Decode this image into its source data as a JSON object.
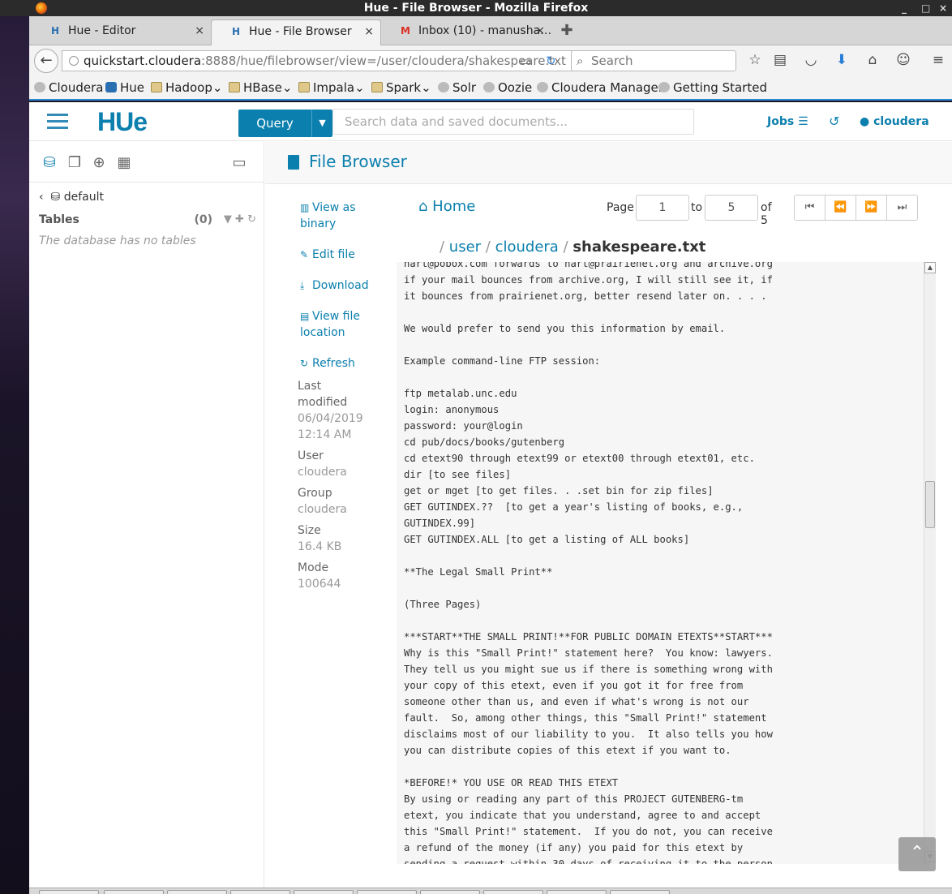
{
  "window": {
    "title": "Hue - File Browser - Mozilla Firefox",
    "controls": [
      "_",
      "□",
      "×"
    ]
  },
  "tabs": [
    {
      "label": "Hue - Editor",
      "icon": "hue-icon",
      "active": false
    },
    {
      "label": "Hue - File Browser",
      "icon": "hue-icon",
      "active": true
    },
    {
      "label": "Inbox (10) - manusha…",
      "icon": "gmail-icon",
      "active": false
    }
  ],
  "newtab_label": "✚",
  "tab_close": "×",
  "nav": {
    "back": "←",
    "url_host": "quickstart.cloudera",
    "url_rest": ":8888/hue/filebrowser/view=/user/cloudera/shakespeare.txt",
    "search_placeholder": "Search"
  },
  "bookmarks": [
    {
      "label": "Cloudera",
      "icon": "globe"
    },
    {
      "label": "Hue",
      "icon": "hue"
    },
    {
      "label": "Hadoop",
      "icon": "folder",
      "menu": true
    },
    {
      "label": "HBase",
      "icon": "folder",
      "menu": true
    },
    {
      "label": "Impala",
      "icon": "folder",
      "menu": true
    },
    {
      "label": "Spark",
      "icon": "folder",
      "menu": true
    },
    {
      "label": "Solr",
      "icon": "globe"
    },
    {
      "label": "Oozie",
      "icon": "globe"
    },
    {
      "label": "Cloudera Manager",
      "icon": "globe"
    },
    {
      "label": "Getting Started",
      "icon": "globe"
    }
  ],
  "header": {
    "logo": "HUe",
    "query_label": "Query",
    "search_placeholder": "Search data and saved documents...",
    "jobs_label": "Jobs",
    "user_label": "cloudera"
  },
  "left_panel": {
    "database": "default",
    "tables_label": "Tables",
    "tables_count": "(0)",
    "empty_message": "The database has no tables"
  },
  "file_browser": {
    "title": "File Browser",
    "actions": {
      "view_binary": [
        "View as",
        "binary"
      ],
      "edit": "Edit file",
      "download": "Download",
      "view_location": [
        "View file",
        "location"
      ],
      "refresh": "Refresh"
    },
    "meta": {
      "last_modified_label": [
        "Last",
        "modified"
      ],
      "last_modified_value": [
        "06/04/2019",
        "12:14 AM"
      ],
      "user_label": "User",
      "user_value": "cloudera",
      "group_label": "Group",
      "group_value": "cloudera",
      "size_label": "Size",
      "size_value": "16.4 KB",
      "mode_label": "Mode",
      "mode_value": "100644"
    },
    "home_label": "Home",
    "pager": {
      "page_label": "Page",
      "from": "1",
      "to_label": "to",
      "to": "5",
      "of_label": "of 5"
    },
    "breadcrumb": {
      "user": "user",
      "cloudera": "cloudera",
      "file": "shakespeare.txt"
    },
    "content": "hart@pobox.com forwards to hart@prairienet.org and archive.org\nif your mail bounces from archive.org, I will still see it, if\nit bounces from prairienet.org, better resend later on. . . .\n\nWe would prefer to send you this information by email.\n\nExample command-line FTP session:\n\nftp metalab.unc.edu\nlogin: anonymous\npassword: your@login\ncd pub/docs/books/gutenberg\ncd etext90 through etext99 or etext00 through etext01, etc.\ndir [to see files]\nget or mget [to get files. . .set bin for zip files]\nGET GUTINDEX.??  [to get a year's listing of books, e.g.,\nGUTINDEX.99]\nGET GUTINDEX.ALL [to get a listing of ALL books]\n\n**The Legal Small Print**\n\n(Three Pages)\n\n***START**THE SMALL PRINT!**FOR PUBLIC DOMAIN ETEXTS**START***\nWhy is this \"Small Print!\" statement here?  You know: lawyers.\nThey tell us you might sue us if there is something wrong with\nyour copy of this etext, even if you got it for free from\nsomeone other than us, and even if what's wrong is not our\nfault.  So, among other things, this \"Small Print!\" statement\ndisclaims most of our liability to you.  It also tells you how\nyou can distribute copies of this etext if you want to.\n\n*BEFORE!* YOU USE OR READ THIS ETEXT\nBy using or reading any part of this PROJECT GUTENBERG-tm\netext, you indicate that you understand, agree to and accept\nthis \"Small Print!\" statement.  If you do not, you can receive\na refund of the money (if any) you paid for this etext by\nsending a request within 30 days of receiving it to the person"
  }
}
